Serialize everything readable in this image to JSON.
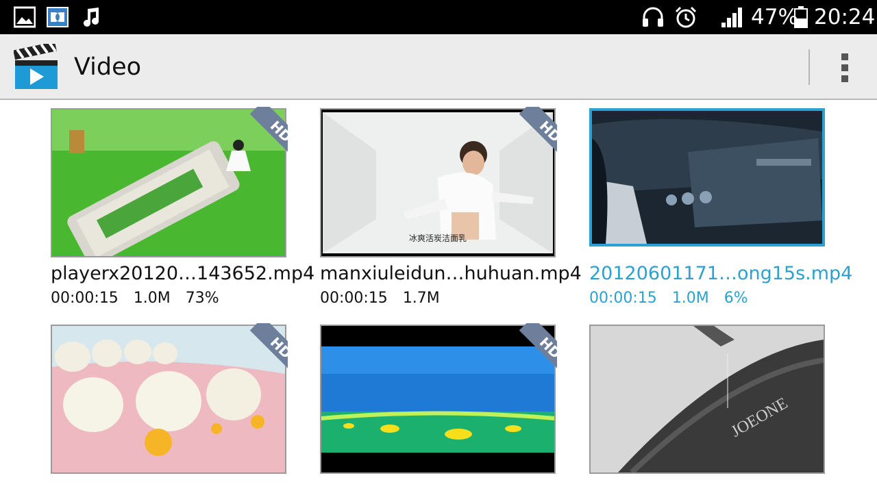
{
  "status_bar": {
    "battery": "47%",
    "time": "20:24"
  },
  "action_bar": {
    "title": "Video"
  },
  "videos": [
    {
      "title": "playerx20120…143652.mp4",
      "duration": "00:00:15",
      "size": "1.0M",
      "progress": "73%",
      "hd": "HD"
    },
    {
      "title": "manxiuleidun…huhuan.mp4",
      "duration": "00:00:15",
      "size": "1.7M",
      "progress": "",
      "hd": "HD"
    },
    {
      "title": "20120601171…ong15s.mp4",
      "duration": "00:00:15",
      "size": "1.0M",
      "progress": "6%",
      "hd": ""
    },
    {
      "title": "",
      "duration": "",
      "size": "",
      "progress": "",
      "hd": "HD"
    },
    {
      "title": "",
      "duration": "",
      "size": "",
      "progress": "",
      "hd": "HD"
    },
    {
      "title": "",
      "duration": "",
      "size": "",
      "progress": "",
      "hd": ""
    }
  ],
  "thumb_captions": {
    "v2": "冰爽活炭洁面乳",
    "v4": "JOEONE"
  },
  "colors": {
    "accent": "#2aa1cf",
    "hd_badge": "#6e7f9c"
  }
}
